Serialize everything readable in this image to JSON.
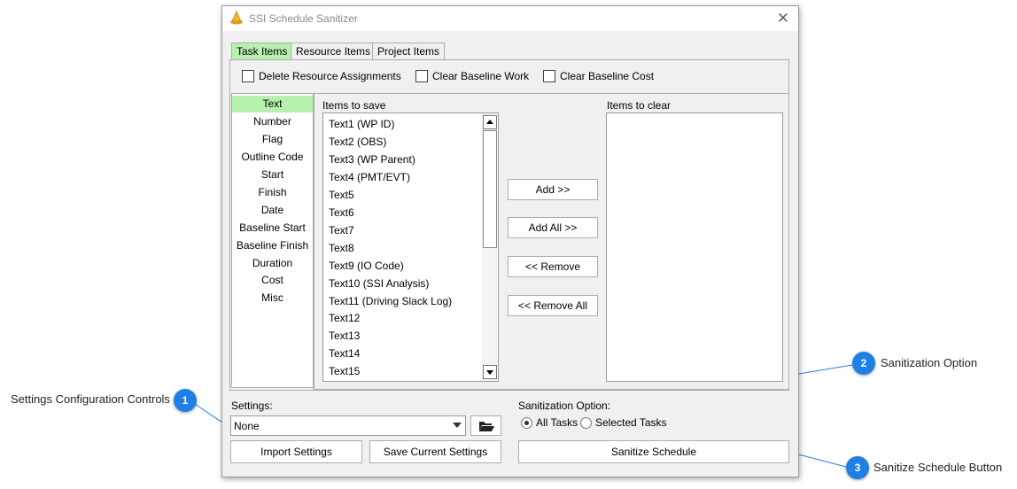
{
  "window": {
    "title": "SSI Schedule Sanitizer",
    "close_glyph": "✕"
  },
  "tabs": [
    "Task Items",
    "Resource Items",
    "Project Items"
  ],
  "checkboxes": [
    "Delete Resource Assignments",
    "Clear Baseline Work",
    "Clear Baseline Cost"
  ],
  "categories": [
    "Text",
    "Number",
    "Flag",
    "Outline Code",
    "Start",
    "Finish",
    "Date",
    "Baseline Start",
    "Baseline Finish",
    "Duration",
    "Cost",
    "Misc"
  ],
  "save_list": {
    "label": "Items to save",
    "items": [
      "Text1 (WP ID)",
      "Text2 (OBS)",
      "Text3 (WP Parent)",
      "Text4 (PMT/EVT)",
      "Text5",
      "Text6",
      "Text7",
      "Text8",
      "Text9 (IO Code)",
      "Text10 (SSI Analysis)",
      "Text11 (Driving Slack Log)",
      "Text12",
      "Text13",
      "Text14",
      "Text15"
    ]
  },
  "clear_list": {
    "label": "Items to clear"
  },
  "buttons": {
    "add": "Add >>",
    "add_all": "Add All >>",
    "remove": "<< Remove",
    "remove_all": "<< Remove All"
  },
  "settings": {
    "label": "Settings:",
    "value": "None",
    "import": "Import Settings",
    "save": "Save Current Settings"
  },
  "sanitization": {
    "label": "Sanitization Option:",
    "options": [
      "All Tasks",
      "Selected Tasks"
    ],
    "selected": "All Tasks",
    "button": "Sanitize Schedule"
  },
  "callouts": [
    {
      "number": "1",
      "text": "Settings Configuration Controls"
    },
    {
      "number": "2",
      "text": "Sanitization Option"
    },
    {
      "number": "3",
      "text": "Sanitize Schedule Button"
    }
  ],
  "colors": {
    "active_tab": "#b8f0b0",
    "callout": "#1f7fe6",
    "logo": "#e0a020"
  }
}
